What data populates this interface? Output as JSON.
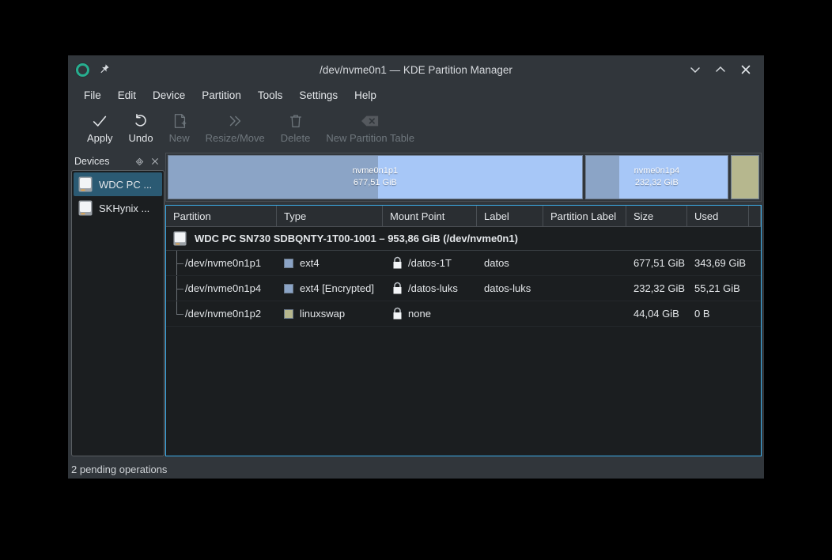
{
  "window": {
    "title": "/dev/nvme0n1 — KDE Partition Manager",
    "app_icon": "kde-partitionmanager-logo-icon",
    "pin_icon": "pin-icon",
    "controls": [
      {
        "name": "minimize-button",
        "icon": "chevron-down-icon"
      },
      {
        "name": "maximize-button",
        "icon": "chevron-up-icon"
      },
      {
        "name": "close-button",
        "icon": "close-x-icon"
      }
    ]
  },
  "menubar": {
    "items": [
      {
        "label": "File"
      },
      {
        "label": "Edit"
      },
      {
        "label": "Device"
      },
      {
        "label": "Partition"
      },
      {
        "label": "Tools"
      },
      {
        "label": "Settings"
      },
      {
        "label": "Help"
      }
    ]
  },
  "toolbar": {
    "items": [
      {
        "label": "Apply",
        "icon": "checkmark-icon",
        "enabled": true
      },
      {
        "label": "Undo",
        "icon": "undo-arrow-icon",
        "enabled": true
      },
      {
        "label": "New",
        "icon": "new-document-icon",
        "enabled": false
      },
      {
        "label": "Resize/Move",
        "icon": "double-chevron-right-icon",
        "enabled": false
      },
      {
        "label": "Delete",
        "icon": "trash-can-icon",
        "enabled": false
      },
      {
        "label": "New Partition Table",
        "icon": "erase-table-icon",
        "enabled": false
      }
    ]
  },
  "devices_dock": {
    "title": "Devices",
    "float_icon": "float-diamond-icon",
    "close_icon": "close-x-icon",
    "items": [
      {
        "label": "WDC PC ...",
        "icon": "hard-disk-icon",
        "selected": true
      },
      {
        "label": "SKHynix ...",
        "icon": "hard-disk-icon",
        "selected": false
      }
    ]
  },
  "partition_graph": {
    "segments": [
      {
        "name": "nvme0n1p1",
        "size_label": "677,51 GiB",
        "flex": 677.51,
        "used_percent": 50.7,
        "kind": "ext4",
        "used_color": "#8ba4c6",
        "free_color": "#a7c7f7"
      },
      {
        "name": "nvme0n1p4",
        "size_label": "232,32 GiB",
        "flex": 232.32,
        "used_percent": 23.8,
        "kind": "ext4-encrypted",
        "used_color": "#8ba4c6",
        "free_color": "#a7c7f7"
      },
      {
        "name": "",
        "size_label": "",
        "flex": 44.04,
        "used_percent": 0,
        "kind": "linuxswap",
        "used_color": "#b6b78e",
        "free_color": "#b6b78e"
      }
    ]
  },
  "table": {
    "headers": [
      "Partition",
      "Type",
      "Mount Point",
      "Label",
      "Partition Label",
      "Size",
      "Used"
    ],
    "device_group": {
      "icon": "hard-disk-icon",
      "title": "WDC PC SN730 SDBQNTY-1T00-1001 – 953,86 GiB (/dev/nvme0n1)"
    },
    "rows": [
      {
        "partition": "/dev/nvme0n1p1",
        "type": "ext4",
        "type_color": "#8ba4c6",
        "mount_icon": "lock-icon",
        "mount_point": "/datos-1T",
        "label": "datos",
        "partition_label": "",
        "size": "677,51 GiB",
        "used": "343,69 GiB"
      },
      {
        "partition": "/dev/nvme0n1p4",
        "type": "ext4 [Encrypted]",
        "type_color": "#8ba4c6",
        "mount_icon": "lock-icon",
        "mount_point": "/datos-luks",
        "label": "datos-luks",
        "partition_label": "",
        "size": "232,32 GiB",
        "used": "55,21 GiB"
      },
      {
        "partition": "/dev/nvme0n1p2",
        "type": "linuxswap",
        "type_color": "#b6b78e",
        "mount_icon": "lock-icon",
        "mount_point": "none",
        "label": "",
        "partition_label": "",
        "size": "44,04 GiB",
        "used": "0 B"
      }
    ]
  },
  "statusbar": {
    "text": "2 pending operations"
  },
  "colors": {
    "window_bg": "#31363b",
    "view_bg": "#1b1e20",
    "focus_border": "#3daee9",
    "selection": "#2b5a73",
    "text": "#e3e6e9",
    "disabled_text": "#6f777d"
  }
}
